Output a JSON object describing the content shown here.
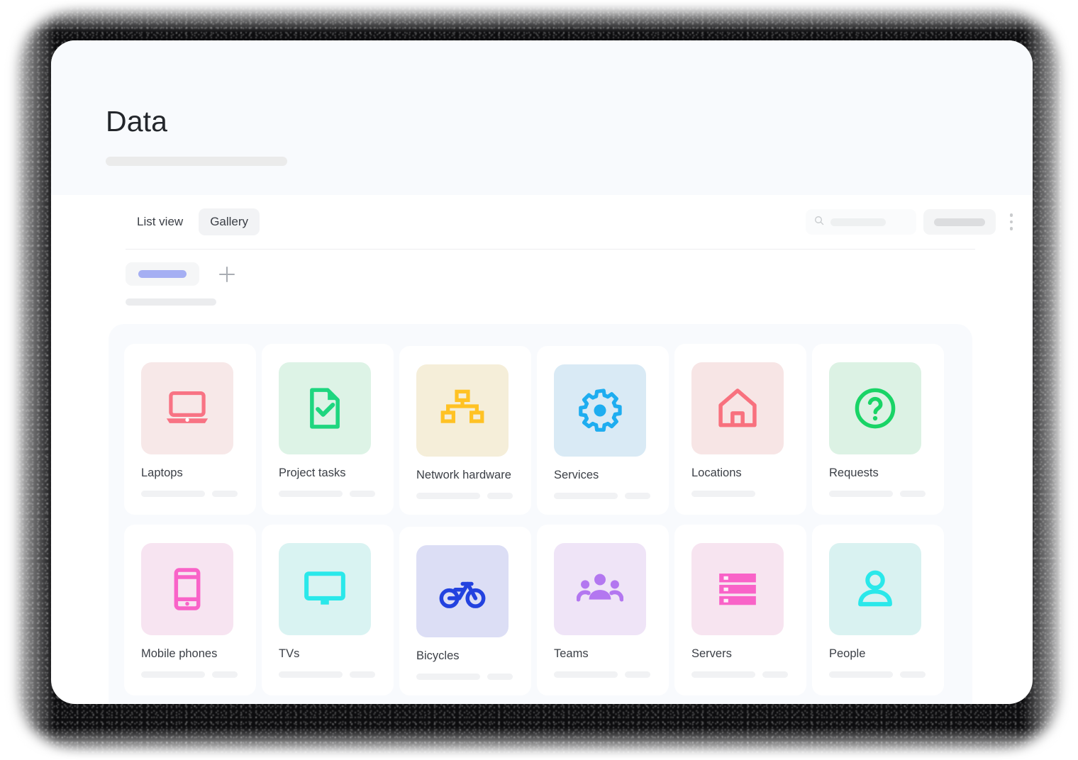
{
  "header": {
    "title": "Data",
    "subtitle_placeholder": ""
  },
  "toolbar": {
    "tabs": [
      {
        "label": "List view",
        "active": false
      },
      {
        "label": "Gallery",
        "active": true
      }
    ],
    "search": {
      "icon": "search-icon",
      "placeholder": ""
    },
    "action_button": {
      "label": ""
    },
    "overflow_menu": {
      "icon": "kebab-menu-icon"
    }
  },
  "filter_row": {
    "chip": {
      "label": "",
      "accent": "#a5aff3"
    },
    "add_button": {
      "icon": "plus-icon"
    },
    "subline": ""
  },
  "gallery": {
    "cards": [
      {
        "label": "Laptops",
        "icon": "laptop-icon",
        "icon_color": "#f87384",
        "bg": "#f7e8e8",
        "bars": 2,
        "nudge": false
      },
      {
        "label": "Project tasks",
        "icon": "document-check-icon",
        "icon_color": "#1ed67f",
        "bg": "#ddf3e6",
        "bars": 2,
        "nudge": false
      },
      {
        "label": "Network hardware",
        "icon": "hierarchy-icon",
        "icon_color": "#ffc224",
        "bg": "#f5eed9",
        "bars": 2,
        "nudge": true
      },
      {
        "label": "Services",
        "icon": "gear-icon",
        "icon_color": "#1eadf0",
        "bg": "#d9eaf5",
        "bars": 2,
        "nudge": true
      },
      {
        "label": "Locations",
        "icon": "home-icon",
        "icon_color": "#f8717e",
        "bg": "#f7e5e5",
        "bars": 1,
        "nudge": false
      },
      {
        "label": "Requests",
        "icon": "question-circle-icon",
        "icon_color": "#19d466",
        "bg": "#dcf2e4",
        "bars": 2,
        "nudge": false
      },
      {
        "label": "Mobile phones",
        "icon": "mobile-phone-icon",
        "icon_color": "#f963c8",
        "bg": "#f7e4f1",
        "bars": 2,
        "nudge": false
      },
      {
        "label": "TVs",
        "icon": "monitor-icon",
        "icon_color": "#2ae8ea",
        "bg": "#d9f3f2",
        "bars": 2,
        "nudge": false
      },
      {
        "label": "Bicycles",
        "icon": "bicycle-icon",
        "icon_color": "#2342df",
        "bg": "#dcdef5",
        "bars": 2,
        "nudge": true
      },
      {
        "label": "Teams",
        "icon": "people-group-icon",
        "icon_color": "#b377f0",
        "bg": "#efe4f7",
        "bars": 2,
        "nudge": false
      },
      {
        "label": "Servers",
        "icon": "server-stack-icon",
        "icon_color": "#f963c8",
        "bg": "#f7e4f0",
        "bars": 2,
        "nudge": false
      },
      {
        "label": "People",
        "icon": "person-icon",
        "icon_color": "#2ae8ea",
        "bg": "#d9f2f1",
        "bars": 2,
        "nudge": false
      }
    ]
  }
}
